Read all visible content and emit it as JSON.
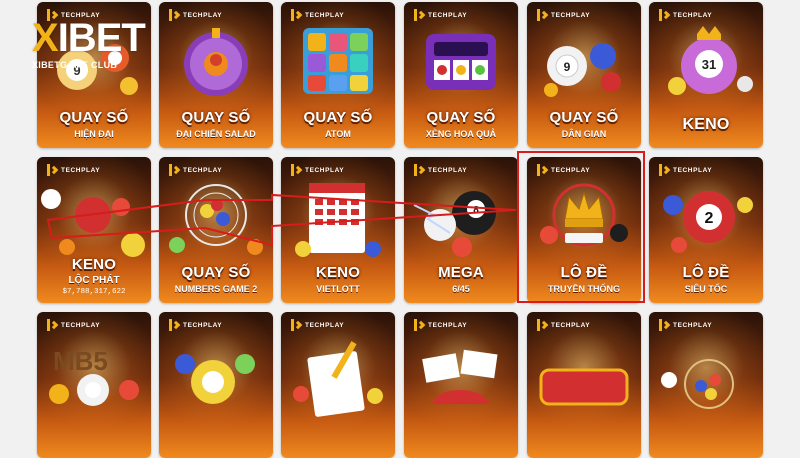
{
  "brand_label": "TECHPLAY",
  "logo": {
    "main_x": "X",
    "main_rest": "IBET",
    "sub": "XIBETGAME CLUB"
  },
  "rows": [
    [
      {
        "title": "QUAY SỐ",
        "subtitle": "HIỆN ĐẠI",
        "icon": "ball-9-icon"
      },
      {
        "title": "QUAY SỐ",
        "subtitle": "ĐẠI CHIẾN SALAD",
        "icon": "salad-wheel-icon"
      },
      {
        "title": "QUAY SỐ",
        "subtitle": "ATOM",
        "icon": "number-grid-icon"
      },
      {
        "title": "QUAY SỐ",
        "subtitle": "XÈNG HOA QUẢ",
        "icon": "slot-machine-icon"
      },
      {
        "title": "QUAY SỐ",
        "subtitle": "DÂN GIAN",
        "icon": "lottery-balls-icon"
      },
      {
        "title": "KENO",
        "subtitle": "",
        "icon": "ball-31-icon"
      }
    ],
    [
      {
        "title": "KENO",
        "subtitle": "LỘC PHÁT",
        "jackpot": "$7,788,317,622",
        "icon": "keno-balls-icon"
      },
      {
        "title": "QUAY SỐ",
        "subtitle": "NUMBERS GAME 2",
        "icon": "lottery-cage-icon"
      },
      {
        "title": "KENO",
        "subtitle": "VIETLOTT",
        "icon": "vietlott-ticket-icon"
      },
      {
        "title": "MEGA",
        "subtitle": "6/45",
        "icon": "billiard-balls-icon"
      },
      {
        "title": "LÔ ĐỀ",
        "subtitle": "TRUYỀN THỐNG",
        "icon": "crown-icon"
      },
      {
        "title": "LÔ ĐỀ",
        "subtitle": "SIÊU TỐC",
        "icon": "ball-2-icon"
      }
    ],
    [
      {
        "title": "",
        "subtitle": "",
        "icon": "mb5-icon"
      },
      {
        "title": "",
        "subtitle": "",
        "icon": "ball-55-icon"
      },
      {
        "title": "",
        "subtitle": "",
        "icon": "ticket-pencil-icon"
      },
      {
        "title": "",
        "subtitle": "",
        "icon": "car-tickets-icon"
      },
      {
        "title": "",
        "subtitle": "",
        "icon": "xeng-sign-icon"
      },
      {
        "title": "",
        "subtitle": "",
        "icon": "cage-balls-icon"
      }
    ]
  ],
  "colors": {
    "brand_gold": "#f2b21a",
    "highlight_red": "#d81b1b",
    "tile_dark": "#2a1208",
    "tile_orange": "#f08a1e"
  }
}
